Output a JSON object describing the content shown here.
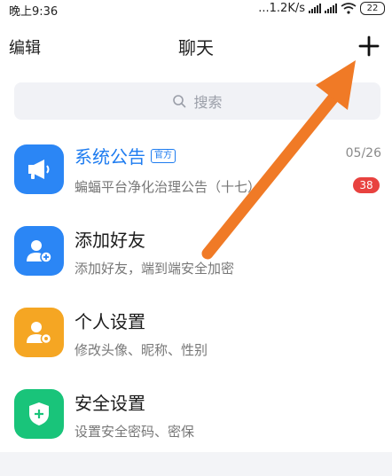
{
  "status_bar": {
    "time": "晚上9:36",
    "network_speed": "...1.2K/s",
    "battery": "22"
  },
  "nav": {
    "left_label": "编辑",
    "title": "聊天",
    "plus_label": "+"
  },
  "search": {
    "placeholder": "搜索"
  },
  "items": [
    {
      "title": "系统公告",
      "badge": "官方",
      "subtitle": "蝙蝠平台净化治理公告（十七）",
      "time": "05/26",
      "unread": "38",
      "color": "#2b86f5",
      "icon": "megaphone-icon"
    },
    {
      "title": "添加好友",
      "subtitle": "添加好友，端到端安全加密",
      "color": "#2b86f5",
      "icon": "add-user-icon"
    },
    {
      "title": "个人设置",
      "subtitle": "修改头像、昵称、性别",
      "color": "#f5a623",
      "icon": "user-settings-icon"
    },
    {
      "title": "安全设置",
      "subtitle": "设置安全密码、密保",
      "color": "#19c47a",
      "icon": "shield-icon"
    }
  ],
  "colors": {
    "accent_blue": "#1e7cf0",
    "unread_red": "#e8423f",
    "arrow_orange": "#f07a26"
  }
}
